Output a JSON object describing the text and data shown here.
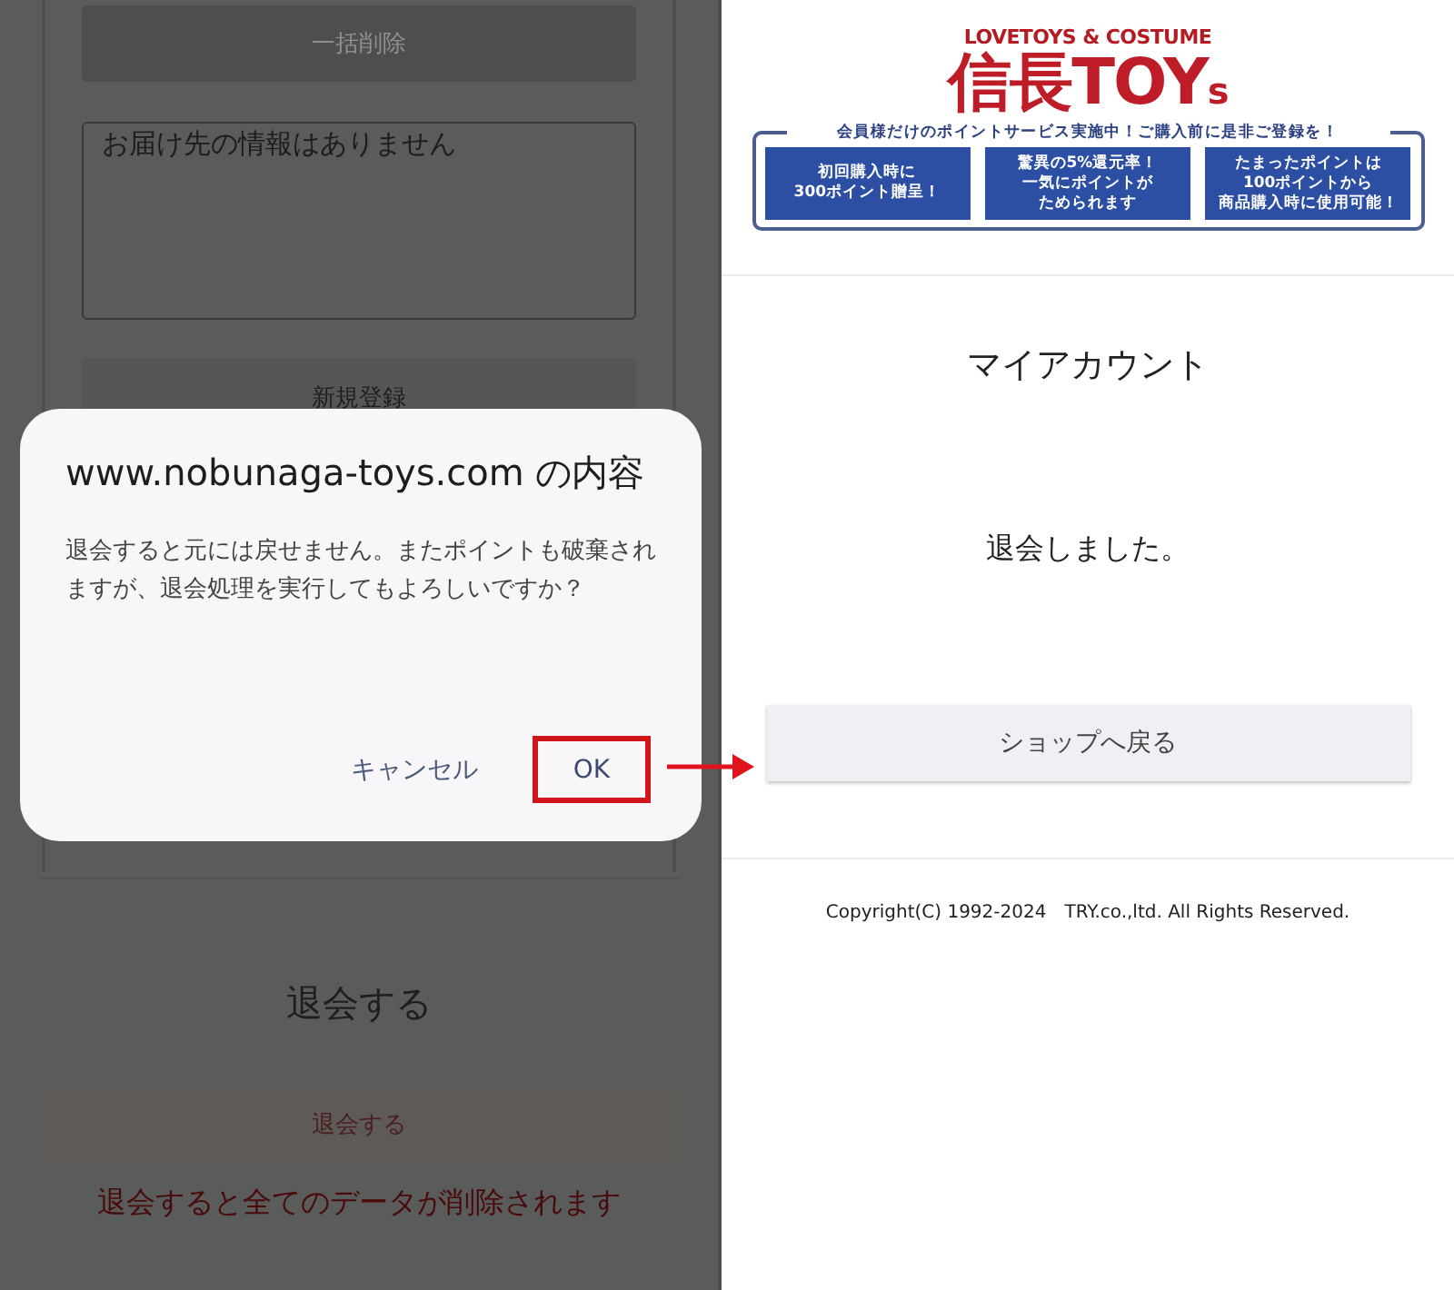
{
  "left_screen": {
    "bulk_delete_button": "一括削除",
    "address_box": "お届け先の情報はありません",
    "new_register_button": "新規登録",
    "withdraw_heading": "退会する",
    "withdraw_button": "退会する",
    "withdraw_warning": "退会すると全てのデータが削除されます",
    "dialog": {
      "title": "www.nobunaga-toys.com の内容",
      "message": "退会すると元には戻せません。またポイントも破棄されますが、退会処理を実行してもよろしいですか？",
      "buttons": [
        {
          "label": "キャンセル",
          "kind": "text"
        },
        {
          "label": "OK",
          "kind": "highlighted"
        }
      ]
    }
  },
  "right_screen": {
    "logo": {
      "tagline": "LOVETOYS & COSTUME",
      "name": "信長TOY$_{s}$"
    },
    "banner": {
      "header": "会員様だけのポイントサービス実施中！ご購入前に是非ご登録を！",
      "boxes": [
        [
          "初回購入時に",
          "300ポイント贈呈！"
        ],
        [
          "驚異の5%還元率！",
          "一気にポイントが",
          "ためられます"
        ],
        [
          "たまったポイントは",
          "100ポイントから",
          "商品購入時に使用可能！"
        ]
      ]
    },
    "page_title": "マイアカウント",
    "message": "退会しました。",
    "back_button": "ショップへ戻る",
    "copyright": "Copyright(C) 1992-2024　TRY.co.,ltd. All Rights Reserved."
  }
}
